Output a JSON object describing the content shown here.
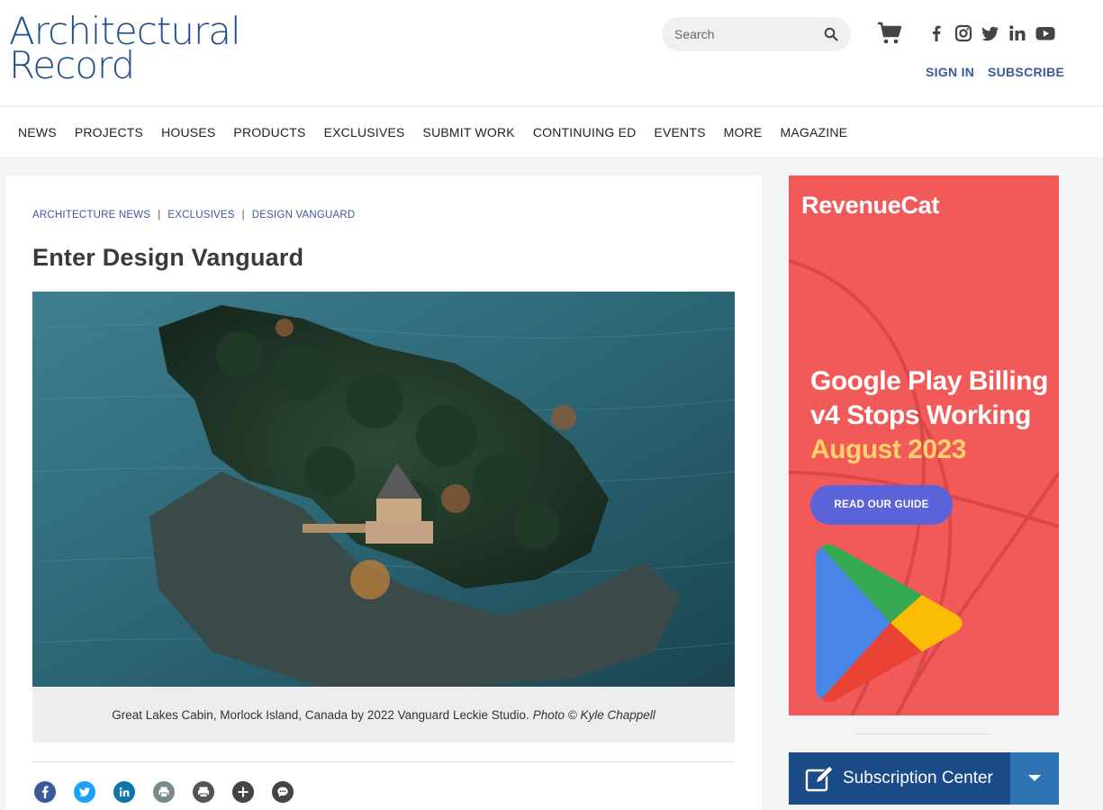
{
  "logo": {
    "line1": "Architectural",
    "line2": "Record"
  },
  "search": {
    "placeholder": "Search"
  },
  "account": {
    "sign_in": "SIGN IN",
    "subscribe": "SUBSCRIBE"
  },
  "nav": {
    "items": [
      "NEWS",
      "PROJECTS",
      "HOUSES",
      "PRODUCTS",
      "EXCLUSIVES",
      "SUBMIT WORK",
      "CONTINUING ED",
      "EVENTS",
      "MORE",
      "MAGAZINE"
    ]
  },
  "article": {
    "breadcrumbs": [
      "ARCHITECTURE NEWS",
      "EXCLUSIVES",
      "DESIGN VANGUARD"
    ],
    "breadcrumb_sep": "|",
    "title": "Enter Design Vanguard",
    "caption_text": "Great Lakes Cabin, Morlock Island, Canada by 2022 Vanguard Leckie Studio.",
    "caption_credit": "Photo © Kyle Chappell"
  },
  "ad": {
    "brand": "RevenueCat",
    "headline_1": "Google Play Billing",
    "headline_2": "v4 Stops Working",
    "headline_3": "August 2023",
    "cta": "READ OUR GUIDE"
  },
  "subscription": {
    "label": "Subscription Center"
  },
  "colors": {
    "brand_blue": "#1f4f8a",
    "link_blue": "#3a5a9a",
    "ad_bg": "#f25a5a",
    "ad_cta": "#5a63d8",
    "ad_yellow": "#ffd26b",
    "sub_bg": "#1b4c87",
    "sub_dropdown": "#2e74b5"
  }
}
